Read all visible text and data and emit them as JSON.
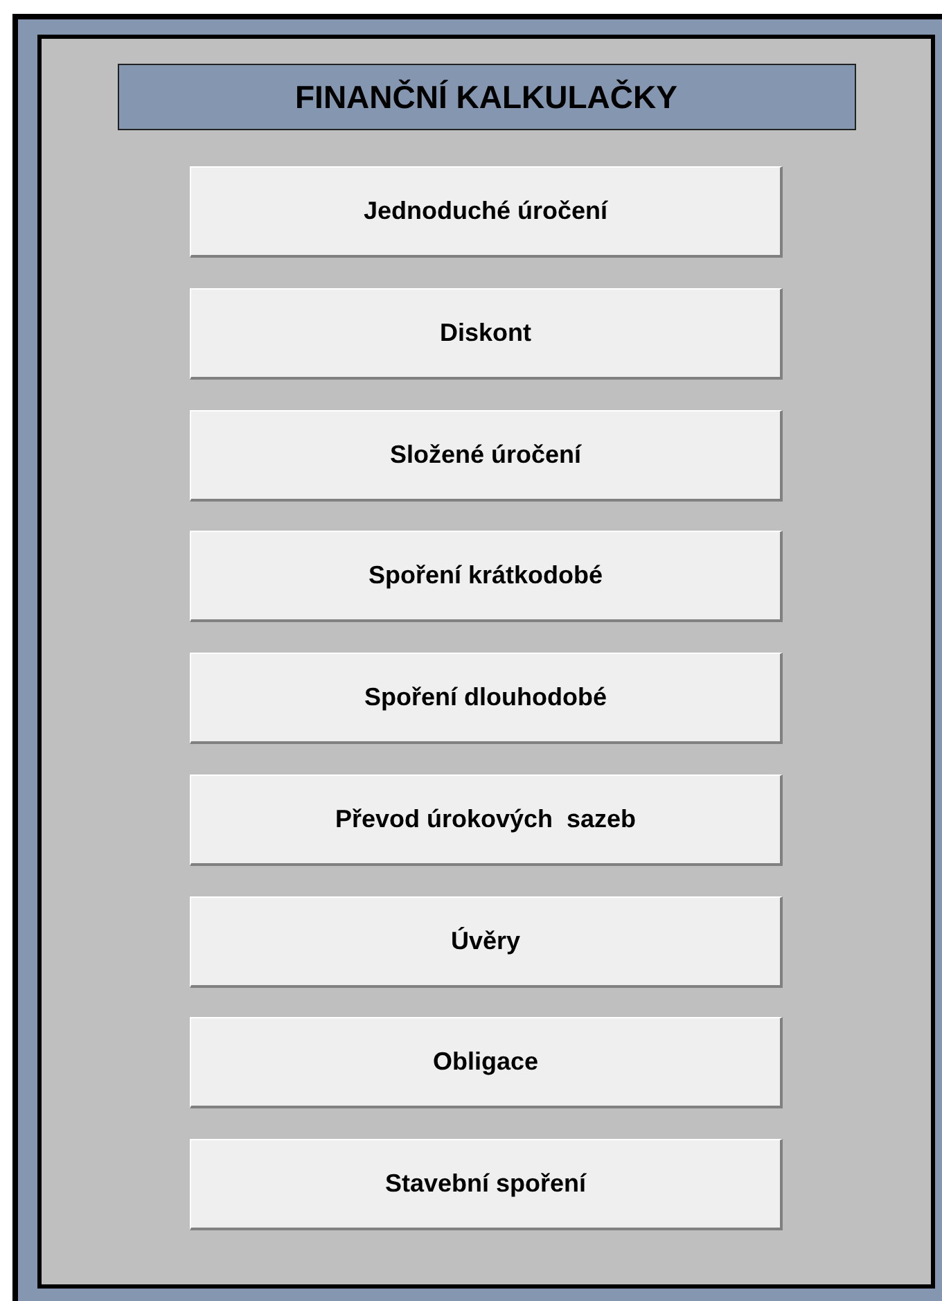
{
  "title": "FINANČNÍ KALKULAČKY",
  "buttons": [
    {
      "label": "Jednoduché úročení"
    },
    {
      "label": "Diskont"
    },
    {
      "label": "Složené úročení"
    },
    {
      "label": "Spoření krátkodobé"
    },
    {
      "label": "Spoření dlouhodobé"
    },
    {
      "label": "Převod úrokových  sazeb"
    },
    {
      "label": "Úvěry"
    },
    {
      "label": "Obligace"
    },
    {
      "label": "Stavební spoření"
    }
  ]
}
